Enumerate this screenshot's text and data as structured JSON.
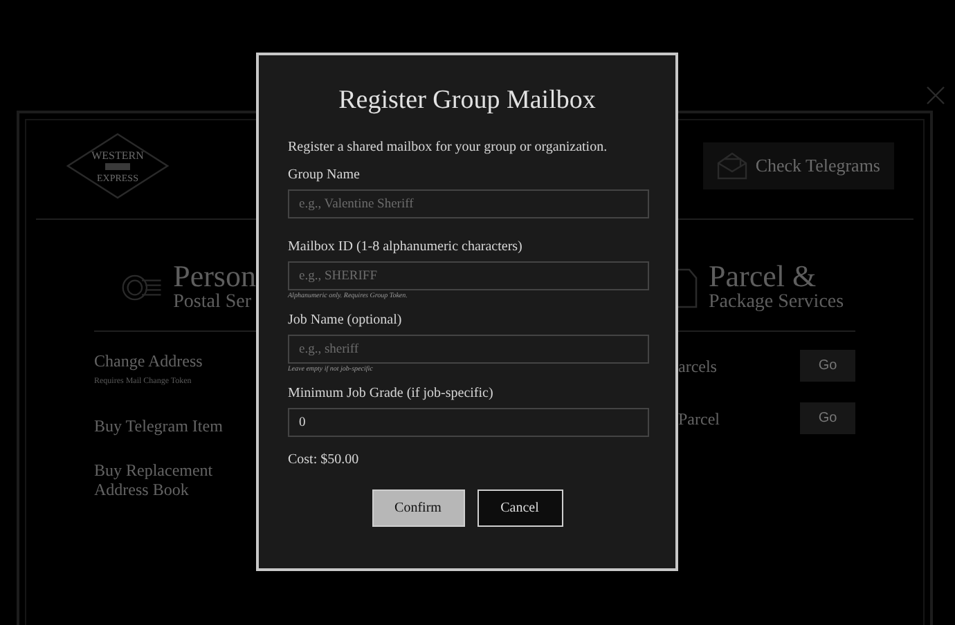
{
  "background_page": {
    "logo_text": [
      "WESTERN",
      "EXPRESS"
    ],
    "check_telegrams_button": "Check Telegrams",
    "sections": [
      {
        "kind": "postal",
        "title": "Person",
        "subtitle": "Postal Ser",
        "items": [
          {
            "label": "Change Address",
            "hint": "Requires Mail Change Token"
          },
          {
            "label": "Buy Telegram Item"
          },
          {
            "label": "Buy Replacement Address Book"
          }
        ]
      },
      {
        "kind": "parcel",
        "title": "Parcel &",
        "subtitle": "Package Services",
        "items": [
          {
            "label": "arcels",
            "button": "Go"
          },
          {
            "label": "Parcel",
            "button": "Go"
          }
        ]
      }
    ]
  },
  "dialog": {
    "title": "Register Group Mailbox",
    "intro": "Register a shared mailbox for your group or organization.",
    "fields": [
      {
        "label": "Group Name",
        "placeholder": "e.g., Valentine Sheriff"
      },
      {
        "label": "Mailbox ID (1-8 alphanumeric characters)",
        "placeholder": "e.g., SHERIFF",
        "hint": "Alphanumeric only. Requires Group Token."
      },
      {
        "label": "Job Name (optional)",
        "placeholder": "e.g., sheriff",
        "hint": "Leave empty if not job-specific"
      },
      {
        "label": "Minimum Job Grade (if job-specific)",
        "value": "0"
      }
    ],
    "cost": "Cost: $50.00",
    "buttons": [
      {
        "label": "Confirm",
        "kind": "primary"
      },
      {
        "label": "Cancel",
        "kind": "secondary"
      }
    ]
  }
}
